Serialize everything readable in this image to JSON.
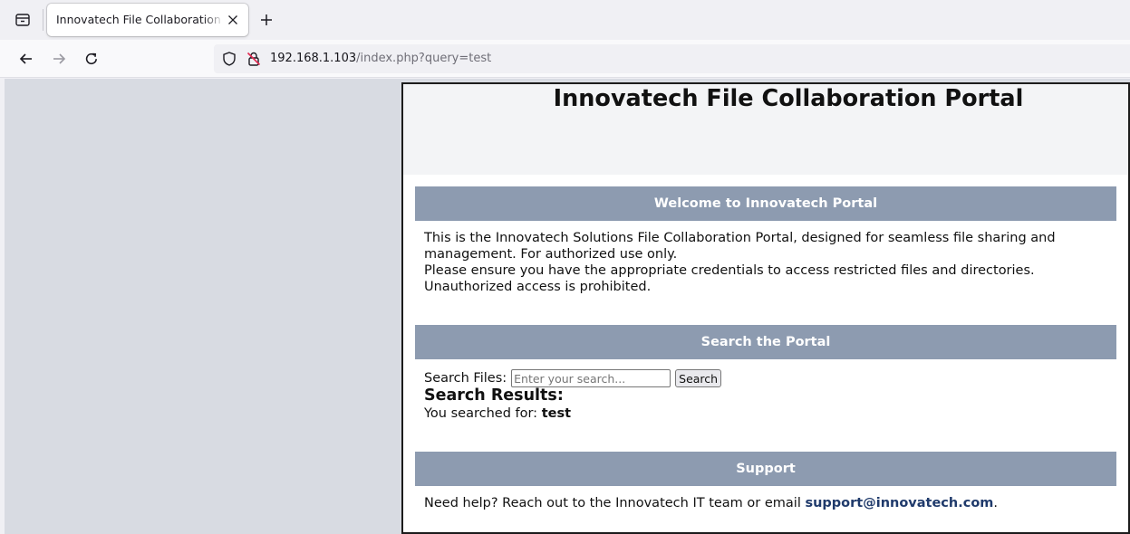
{
  "browser": {
    "tab": {
      "title": "Innovatech File Collaboration Portal"
    },
    "url": {
      "host": "192.168.1.103",
      "path": "/index.php?query=test"
    }
  },
  "page": {
    "title": "Innovatech File Collaboration Portal",
    "welcome": {
      "heading": "Welcome to Innovatech Portal",
      "line1": "This is the Innovatech Solutions File Collaboration Portal, designed for seamless file sharing and",
      "line2": "management. For authorized use only.",
      "line3": "Please ensure you have the appropriate credentials to access restricted files and directories.",
      "line4": "Unauthorized access is prohibited."
    },
    "search": {
      "heading": "Search the Portal",
      "label": "Search Files:",
      "placeholder": "Enter your search...",
      "value": "",
      "button": "Search",
      "results_heading": "Search Results:",
      "searched_prefix": "You searched for: ",
      "searched_term": "test"
    },
    "support": {
      "heading": "Support",
      "text": "Need help? Reach out to the Innovatech IT team or email ",
      "email": "support@innovatech.com",
      "suffix": "."
    }
  },
  "colors": {
    "section_bar": "#8d9bb0",
    "viewport_bg": "#d8dbe2",
    "link": "#1f3a6b"
  }
}
